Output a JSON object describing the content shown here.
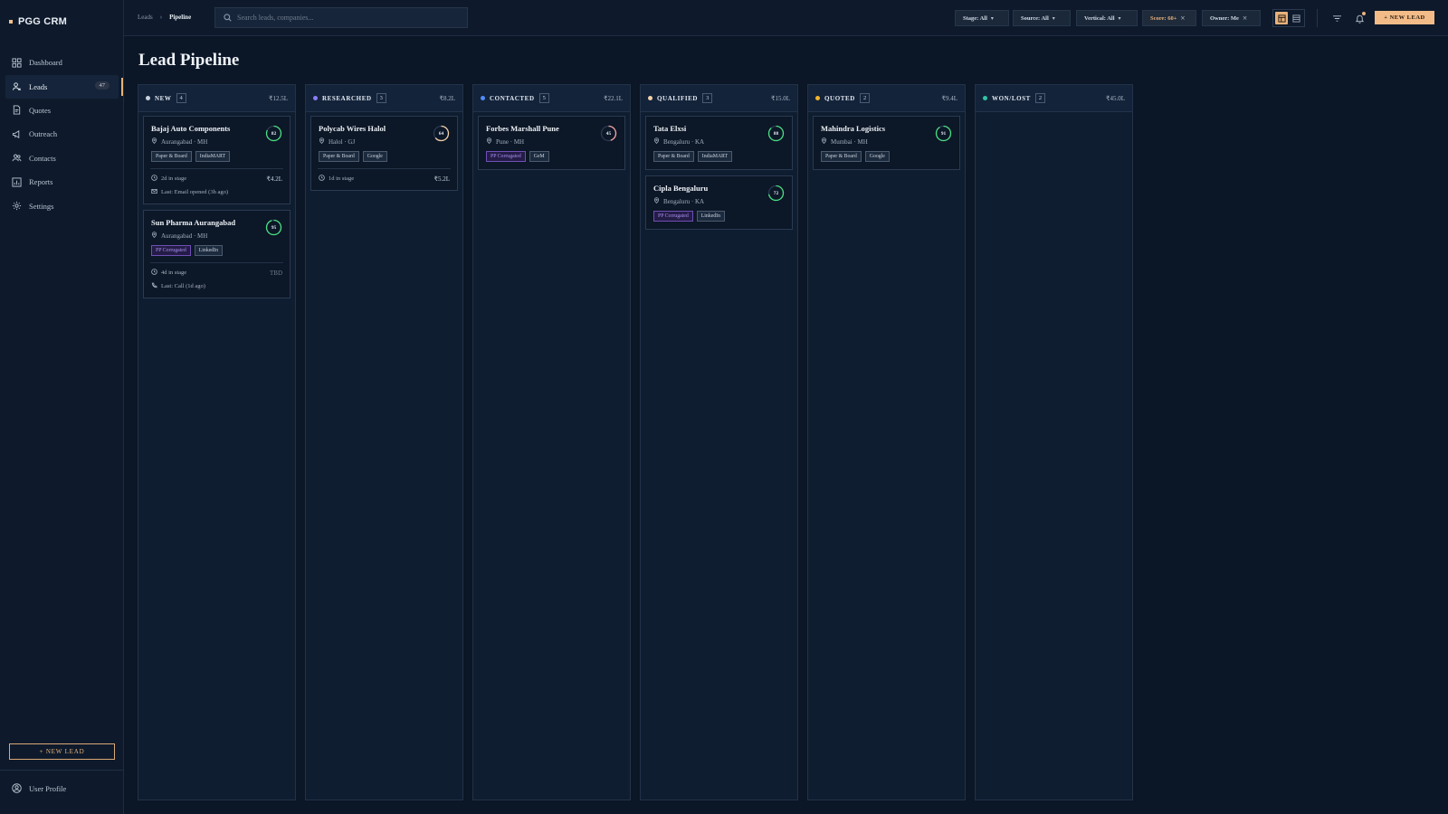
{
  "app": {
    "name": "PGG CRM"
  },
  "sidebar": {
    "items": [
      {
        "label": "Dashboard",
        "icon": "dashboard-icon"
      },
      {
        "label": "Leads",
        "icon": "leads-icon",
        "badge": "47",
        "active": true
      },
      {
        "label": "Quotes",
        "icon": "quotes-icon"
      },
      {
        "label": "Outreach",
        "icon": "megaphone-icon"
      },
      {
        "label": "Contacts",
        "icon": "contacts-icon"
      },
      {
        "label": "Reports",
        "icon": "reports-icon"
      },
      {
        "label": "Settings",
        "icon": "gear-icon"
      }
    ],
    "new_lead_label": "+ NEW LEAD",
    "user_profile_label": "User Profile"
  },
  "topbar": {
    "breadcrumb": [
      "Leads",
      "Pipeline"
    ],
    "search_placeholder": "Search leads, companies...",
    "filters": [
      {
        "label": "Stage: All",
        "type": "dropdown"
      },
      {
        "label": "Source: All",
        "type": "dropdown"
      },
      {
        "label": "Vertical: All",
        "type": "dropdown"
      },
      {
        "label": "Score: 60+",
        "type": "removable",
        "highlight": true
      },
      {
        "label": "Owner: Me",
        "type": "removable"
      }
    ],
    "new_lead_label": "+ NEW LEAD"
  },
  "page": {
    "title": "Lead Pipeline"
  },
  "colors": {
    "accent": "#e8b27b",
    "new": "#c9d3e0",
    "researched": "#8b7cf6",
    "contacted": "#4f8ef7",
    "qualified": "#f3d1a8",
    "quoted": "#f0b429",
    "won_lost": "#2ec4a6",
    "score_high": "#4ade80",
    "score_mid": "#f5a3a3"
  },
  "columns": [
    {
      "name": "NEW",
      "count": "4",
      "total": "₹12.5L",
      "dot": "#c9d3e0",
      "cards": [
        {
          "name": "Bajaj Auto Components",
          "location": "Aurangabad · MH",
          "score": "82",
          "score_value": 0.82,
          "score_color": "#4ade80",
          "tags": [
            {
              "label": "Paper & Board",
              "kind": "grey"
            },
            {
              "label": "IndiaMART",
              "kind": "grey"
            }
          ],
          "stage_time": "2d in stage",
          "value": "₹4.2L",
          "last": "Last: Email opened (3h ago)",
          "last_icon": "mail-icon"
        },
        {
          "name": "Sun Pharma Aurangabad",
          "location": "Aurangabad · MH",
          "score": "95",
          "score_value": 0.95,
          "score_color": "#4ade80",
          "tags": [
            {
              "label": "PP Corrugated",
              "kind": "purple"
            },
            {
              "label": "LinkedIn",
              "kind": "grey"
            }
          ],
          "stage_time": "4d in stage",
          "value": "TBD",
          "last": "Last: Call (1d ago)",
          "last_icon": "phone-icon"
        }
      ]
    },
    {
      "name": "RESEARCHED",
      "count": "3",
      "total": "₹8.2L",
      "dot": "#8b7cf6",
      "cards": [
        {
          "name": "Polycab Wires Halol",
          "location": "Halol · GJ",
          "score": "64",
          "score_value": 0.64,
          "score_color": "#f3d1a8",
          "tags": [
            {
              "label": "Paper & Board",
              "kind": "grey"
            },
            {
              "label": "Google",
              "kind": "grey"
            }
          ],
          "stage_time": "1d in stage",
          "value": "₹5.2L"
        }
      ]
    },
    {
      "name": "CONTACTED",
      "count": "5",
      "total": "₹22.1L",
      "dot": "#4f8ef7",
      "cards": [
        {
          "name": "Forbes Marshall Pune",
          "location": "Pune · MH",
          "score": "45",
          "score_value": 0.45,
          "score_color": "#f5a3a3",
          "tags": [
            {
              "label": "PP Corrugated",
              "kind": "purple"
            },
            {
              "label": "GeM",
              "kind": "grey"
            }
          ]
        }
      ]
    },
    {
      "name": "QUALIFIED",
      "count": "3",
      "total": "₹15.0L",
      "dot": "#f3d1a8",
      "cards": [
        {
          "name": "Tata Elxsi",
          "location": "Bengaluru · KA",
          "score": "88",
          "score_value": 0.88,
          "score_color": "#4ade80",
          "tags": [
            {
              "label": "Paper & Board",
              "kind": "grey"
            },
            {
              "label": "IndiaMART",
              "kind": "grey"
            }
          ]
        },
        {
          "name": "Cipla Bengaluru",
          "location": "Bengaluru · KA",
          "score": "72",
          "score_value": 0.72,
          "score_color": "#4ade80",
          "tags": [
            {
              "label": "PP Corrugated",
              "kind": "purple"
            },
            {
              "label": "LinkedIn",
              "kind": "grey"
            }
          ]
        }
      ]
    },
    {
      "name": "QUOTED",
      "count": "2",
      "total": "₹9.4L",
      "dot": "#f0b429",
      "cards": [
        {
          "name": "Mahindra Logistics",
          "location": "Mumbai · MH",
          "score": "91",
          "score_value": 0.91,
          "score_color": "#4ade80",
          "tags": [
            {
              "label": "Paper & Board",
              "kind": "grey"
            },
            {
              "label": "Google",
              "kind": "grey"
            }
          ]
        }
      ]
    },
    {
      "name": "WON/LOST",
      "count": "2",
      "total": "₹45.0L",
      "dot": "#2ec4a6",
      "cards": []
    }
  ]
}
